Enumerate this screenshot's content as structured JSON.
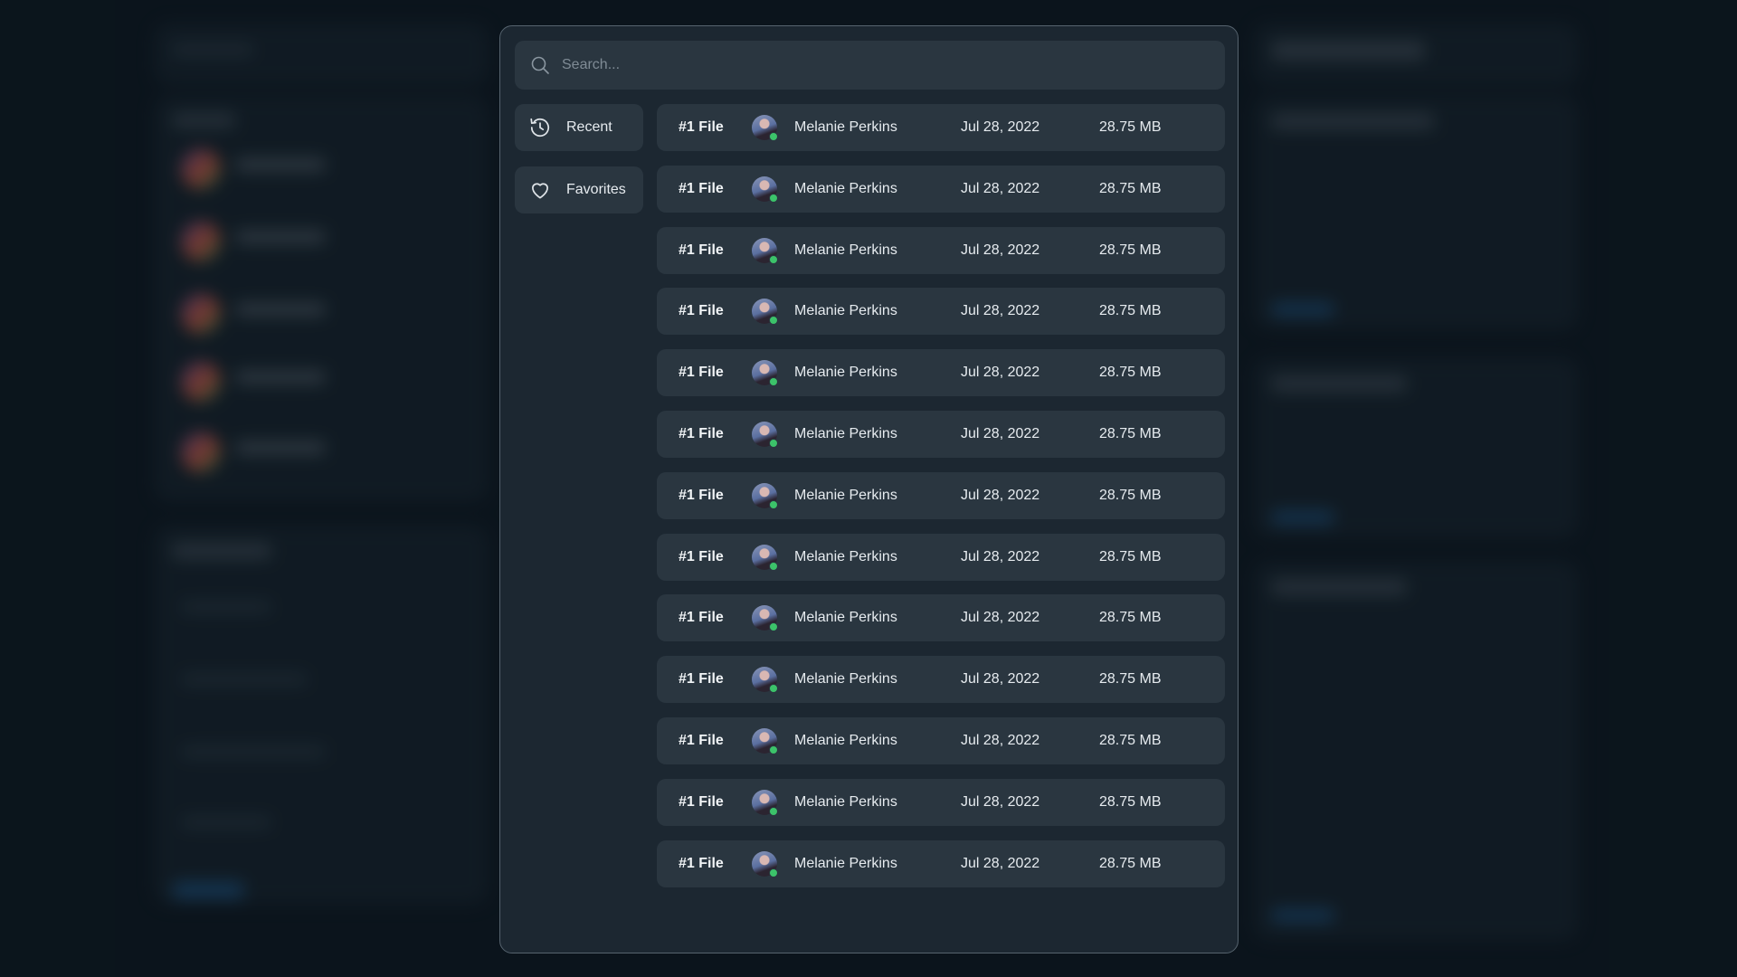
{
  "search": {
    "placeholder": "Search..."
  },
  "sidebar": {
    "items": [
      {
        "label": "Recent",
        "icon": "history-icon"
      },
      {
        "label": "Favorites",
        "icon": "heart-icon"
      }
    ]
  },
  "files": [
    {
      "name": "#1 File",
      "owner": "Melanie Perkins",
      "date": "Jul 28, 2022",
      "size": "28.75 MB"
    },
    {
      "name": "#1 File",
      "owner": "Melanie Perkins",
      "date": "Jul 28, 2022",
      "size": "28.75 MB"
    },
    {
      "name": "#1 File",
      "owner": "Melanie Perkins",
      "date": "Jul 28, 2022",
      "size": "28.75 MB"
    },
    {
      "name": "#1 File",
      "owner": "Melanie Perkins",
      "date": "Jul 28, 2022",
      "size": "28.75 MB"
    },
    {
      "name": "#1 File",
      "owner": "Melanie Perkins",
      "date": "Jul 28, 2022",
      "size": "28.75 MB"
    },
    {
      "name": "#1 File",
      "owner": "Melanie Perkins",
      "date": "Jul 28, 2022",
      "size": "28.75 MB"
    },
    {
      "name": "#1 File",
      "owner": "Melanie Perkins",
      "date": "Jul 28, 2022",
      "size": "28.75 MB"
    },
    {
      "name": "#1 File",
      "owner": "Melanie Perkins",
      "date": "Jul 28, 2022",
      "size": "28.75 MB"
    },
    {
      "name": "#1 File",
      "owner": "Melanie Perkins",
      "date": "Jul 28, 2022",
      "size": "28.75 MB"
    },
    {
      "name": "#1 File",
      "owner": "Melanie Perkins",
      "date": "Jul 28, 2022",
      "size": "28.75 MB"
    },
    {
      "name": "#1 File",
      "owner": "Melanie Perkins",
      "date": "Jul 28, 2022",
      "size": "28.75 MB"
    },
    {
      "name": "#1 File",
      "owner": "Melanie Perkins",
      "date": "Jul 28, 2022",
      "size": "28.75 MB"
    },
    {
      "name": "#1 File",
      "owner": "Melanie Perkins",
      "date": "Jul 28, 2022",
      "size": "28.75 MB"
    }
  ],
  "colors": {
    "modal_bg": "#1c2731",
    "row_bg": "#2a3640",
    "online": "#3cc36a",
    "page_bg": "#0d1821"
  }
}
